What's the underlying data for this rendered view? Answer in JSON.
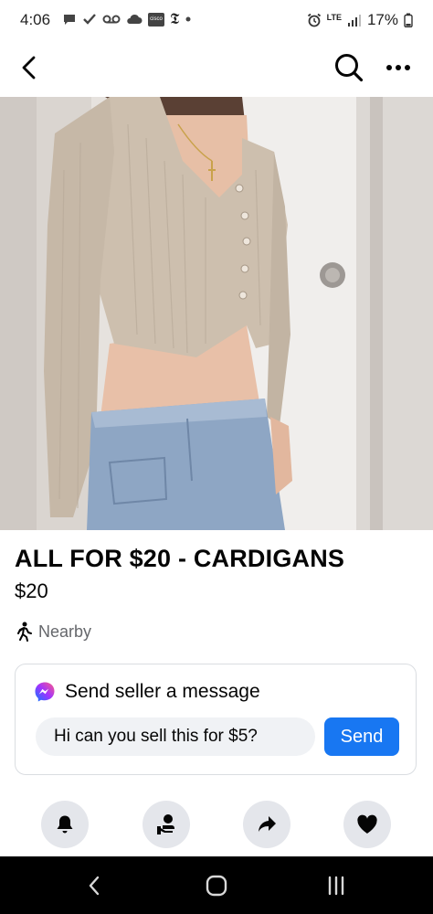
{
  "status_bar": {
    "time": "4:06",
    "left_icons": [
      "chat-bubble-icon",
      "check-icon",
      "voicemail-icon",
      "cloud-icon",
      "cisco-app-icon",
      "nyt-app-icon",
      "dot-icon"
    ],
    "cisco_label": "cisco",
    "nyt_label": "𝕿",
    "network": "LTE",
    "battery": "17%"
  },
  "nav": {
    "back_icon": "chevron-left-icon",
    "search_icon": "search-icon",
    "more_icon": "more-horizontal-icon"
  },
  "listing": {
    "image_count": 7,
    "active_image_index": 0,
    "title": "ALL FOR $20 - CARDIGANS",
    "price": "$20",
    "location": "Nearby",
    "location_icon": "walking-person-icon"
  },
  "message": {
    "icon": "messenger-icon",
    "header": "Send seller a message",
    "input_value": "Hi can you sell this for $5?",
    "send_label": "Send"
  },
  "actions": [
    {
      "name": "notify",
      "icon": "bell-icon"
    },
    {
      "name": "seller-profile",
      "icon": "person-in-hand-icon"
    },
    {
      "name": "share",
      "icon": "share-arrow-icon"
    },
    {
      "name": "save",
      "icon": "heart-icon"
    }
  ],
  "colors": {
    "accent": "#1877f2",
    "text_primary": "#050505",
    "text_secondary": "#65676b",
    "button_bg": "#e4e6eb",
    "input_bg": "#f0f2f5"
  }
}
